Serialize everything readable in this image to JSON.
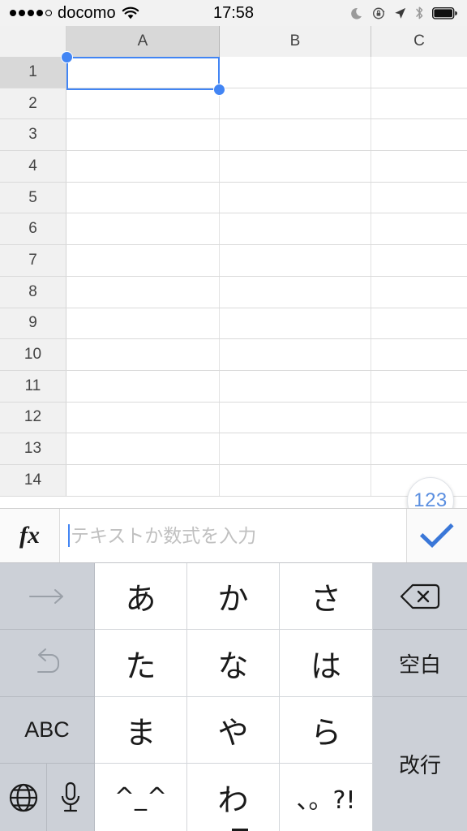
{
  "status_bar": {
    "carrier": "docomo",
    "signal_dots_filled": 4,
    "signal_dots_total": 5,
    "wifi_icon": "wifi-icon",
    "time": "17:58",
    "right_icons": [
      "moon-icon",
      "rotation-lock-icon",
      "location-arrow-icon",
      "bluetooth-icon",
      "battery-icon"
    ]
  },
  "spreadsheet": {
    "columns": [
      {
        "label": "A",
        "selected": true
      },
      {
        "label": "B",
        "selected": false
      },
      {
        "label": "C",
        "selected": false
      }
    ],
    "rows": [
      "1",
      "2",
      "3",
      "4",
      "5",
      "6",
      "7",
      "8",
      "9",
      "10",
      "11",
      "12",
      "13",
      "14"
    ],
    "selected_cell": "A1",
    "selected_cell_value": "",
    "number_fab_label": "123",
    "accent_color": "#4285f4",
    "fab_text_color": "#5b8fe0"
  },
  "formula_bar": {
    "fx_label": "fx",
    "fx_icon": "function-icon",
    "input_value": "",
    "input_placeholder": "テキストか数式を入力",
    "accept_icon": "checkmark-icon",
    "accept_color": "#3a77d8"
  },
  "keyboard": {
    "layout": "japanese-kana-12key",
    "rows": [
      [
        {
          "name": "cursor-right-key",
          "label": "→",
          "type": "fn",
          "state": "disabled"
        },
        {
          "name": "key-a",
          "label": "あ",
          "type": "letter"
        },
        {
          "name": "key-ka",
          "label": "か",
          "type": "letter"
        },
        {
          "name": "key-sa",
          "label": "さ",
          "type": "letter"
        },
        {
          "name": "backspace-key",
          "label": "⌫",
          "type": "fn"
        }
      ],
      [
        {
          "name": "undo-key",
          "label": "↺",
          "type": "fn",
          "state": "disabled"
        },
        {
          "name": "key-ta",
          "label": "た",
          "type": "letter"
        },
        {
          "name": "key-na",
          "label": "な",
          "type": "letter"
        },
        {
          "name": "key-ha",
          "label": "は",
          "type": "letter"
        },
        {
          "name": "space-key",
          "label": "空白",
          "type": "fn"
        }
      ],
      [
        {
          "name": "abc-key",
          "label": "ABC",
          "type": "fn"
        },
        {
          "name": "key-ma",
          "label": "ま",
          "type": "letter"
        },
        {
          "name": "key-ya",
          "label": "や",
          "type": "letter"
        },
        {
          "name": "key-ra",
          "label": "ら",
          "type": "letter"
        },
        {
          "name": "return-key",
          "label": "改行",
          "type": "fn"
        }
      ],
      [
        {
          "name": "globe-key",
          "label": "",
          "type": "fn"
        },
        {
          "name": "microphone-key",
          "label": "",
          "type": "fn"
        },
        {
          "name": "key-emoticon",
          "label": "^_^",
          "type": "letter"
        },
        {
          "name": "key-wa",
          "label": "わ",
          "type": "letter"
        },
        {
          "name": "key-punctuation",
          "label": "、。?!",
          "type": "letter"
        }
      ]
    ]
  }
}
